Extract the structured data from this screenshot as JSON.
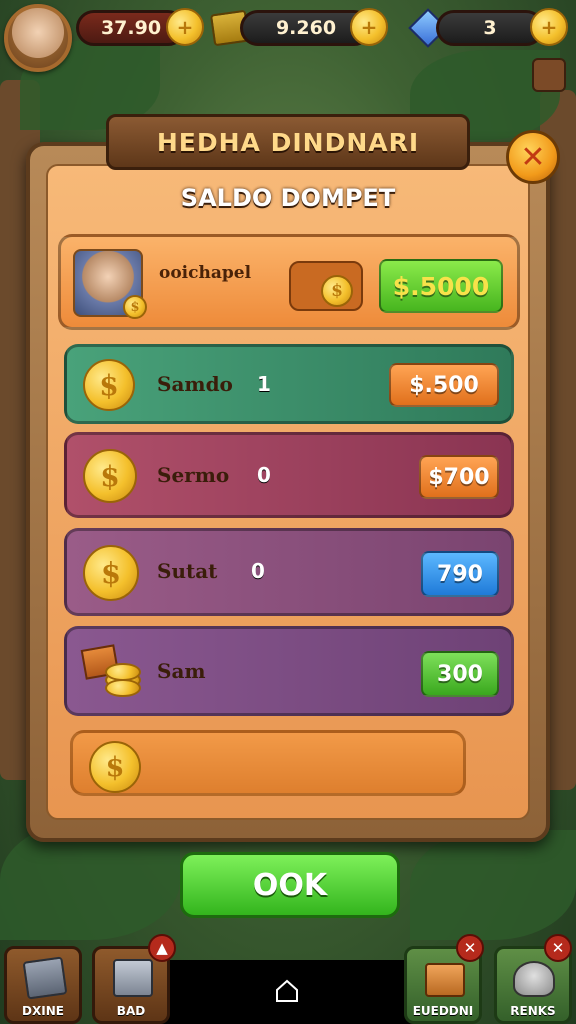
{
  "topbar": {
    "coins_value": "37.90",
    "gold_value": "9.260",
    "gems_value": "3"
  },
  "dialog": {
    "title": "HEDHA DINDNARI",
    "subtitle": "SALDO DOMPET",
    "close_icon": "close-icon",
    "profile_row": {
      "name": "ooichapel",
      "amount": "$.5000"
    },
    "rows": [
      {
        "label": "Samdo",
        "count": "1",
        "amount": "$.500",
        "color": "#3f8a66",
        "button_color": "#f08a2a"
      },
      {
        "label": "Sermo",
        "count": "0",
        "amount": "$700",
        "color": "#9a3f5a",
        "button_color": "#f08a2a"
      },
      {
        "label": "Sutat",
        "count": "0",
        "amount": "790",
        "color": "#8a4f7a",
        "button_color": "#2f8fe0"
      },
      {
        "label": "Sam",
        "count": "",
        "amount": "300",
        "color": "#7a4f82",
        "button_color": "#3fb52a"
      }
    ],
    "ok_label": "OOK"
  },
  "bottom_bar": {
    "tiles": [
      {
        "label": "DXINE"
      },
      {
        "label": "BAD"
      },
      {
        "label": "EUEDDNI"
      },
      {
        "label": "RENKS"
      }
    ]
  },
  "colors": {
    "panel_brown": "#8d6238",
    "panel_orange": "#e89550",
    "ok_green": "#33b51d",
    "profile_button": "#58c72e"
  }
}
